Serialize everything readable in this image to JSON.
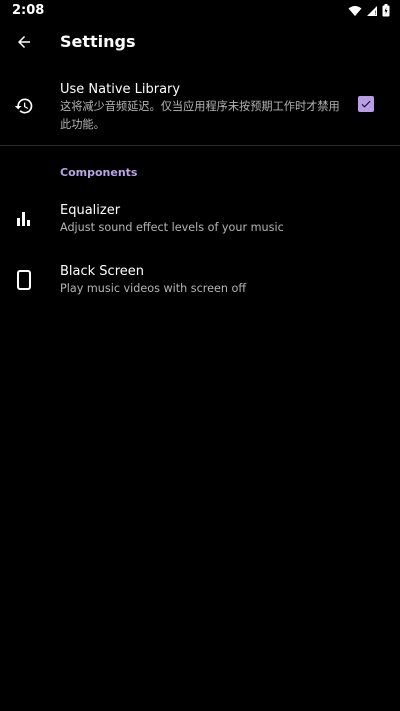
{
  "status_bar": {
    "time": "2:08",
    "icons": [
      "wifi-icon",
      "signal-icon",
      "battery-icon"
    ]
  },
  "app_bar": {
    "title": "Settings",
    "back_icon": "arrow-back-icon"
  },
  "settings": {
    "native_library": {
      "icon": "history-icon",
      "title": "Use Native Library",
      "summary": "这将减少音频延迟。仅当应用程序未按预期工作时才禁用此功能。",
      "checked": true
    },
    "components_header": "Components",
    "equalizer": {
      "icon": "equalizer-icon",
      "title": "Equalizer",
      "summary": "Adjust sound effect levels of your music"
    },
    "black_screen": {
      "icon": "phone-icon",
      "title": "Black Screen",
      "summary": "Play music videos with screen off"
    }
  },
  "colors": {
    "background": "#000000",
    "accent": "#b8a4e6",
    "checkbox": "#b89ee8",
    "secondary_text": "#b4b4b4"
  }
}
